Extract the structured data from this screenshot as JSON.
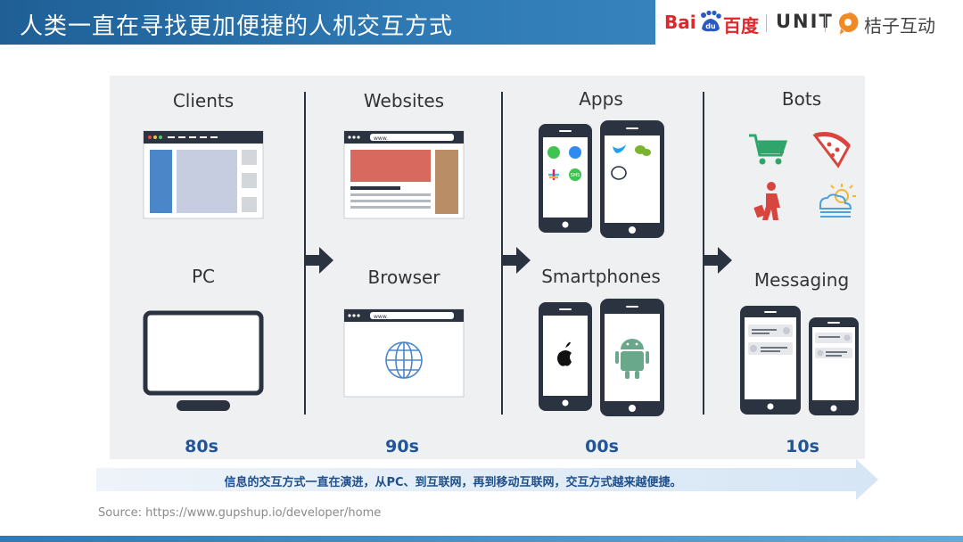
{
  "header": {
    "title": "人类一直在寻找更加便捷的人机交互方式",
    "baidu_word": "Bai",
    "baidu_du": "du",
    "baidu_cn": "百度",
    "unit": "UNIT",
    "partner": "桔子互动",
    "colors": {
      "bar": "#2f7ab5",
      "baidu_red": "#e0262b"
    }
  },
  "columns": [
    {
      "top_label": "Clients",
      "bottom_label": "PC",
      "decade": "80s"
    },
    {
      "top_label": "Websites",
      "bottom_label": "Browser",
      "decade": "90s",
      "url_text": "www."
    },
    {
      "top_label": "Apps",
      "bottom_label": "Smartphones",
      "decade": "00s"
    },
    {
      "top_label": "Bots",
      "bottom_label": "Messaging",
      "decade": "10s"
    }
  ],
  "browser_url": "www.",
  "sms_label": "SMS",
  "banner": "信息的交互方式一直在演进，从PC、到互联网，再到移动互联网，交互方式越来越便捷。",
  "source": "Source: https://www.gupshup.io/developer/home",
  "colors": {
    "decade": "#21559a",
    "dark": "#2b3340"
  }
}
